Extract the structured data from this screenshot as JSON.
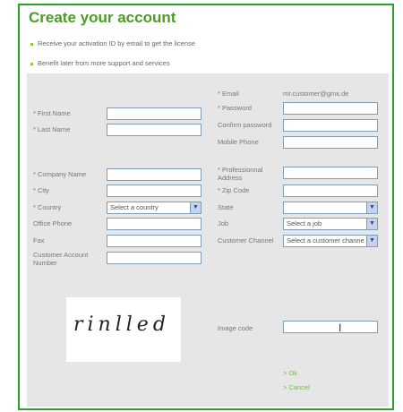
{
  "page": {
    "title": "Create your account",
    "bullets": [
      "Receive your activation ID by email to get the license",
      "Benefit later from more support and services"
    ]
  },
  "form": {
    "left": {
      "first_name": "* First Name",
      "last_name": "* Last Name",
      "company_name": "* Company Name",
      "city": "* City",
      "country": "* Country",
      "country_value": "Select a country",
      "office_phone": "Office Phone",
      "fax": "Fax",
      "customer_account_number": "Customer Account Number"
    },
    "right": {
      "email_label": "* Email",
      "email_value": "mr.customer@gmx.de",
      "password": "* Password",
      "confirm_password": "Confirm password",
      "mobile_phone": "Mobile Phone",
      "professional_address": "* Professionnal Address",
      "zip_code": "* Zip Code",
      "state": "State",
      "state_value": "",
      "job": "Job",
      "job_value": "Select a job",
      "customer_channel": "Customer Channel",
      "customer_channel_value": "Select a customer channe"
    },
    "captcha_text": "rinlled",
    "image_code_label": "Image code",
    "ok_link": "> Ok",
    "cancel_link": "> Cancel"
  },
  "colors": {
    "title": "#4d9b28",
    "frame_border": "#2aa12a",
    "link": "#6cc24a",
    "panel": "#e6e6e6"
  }
}
